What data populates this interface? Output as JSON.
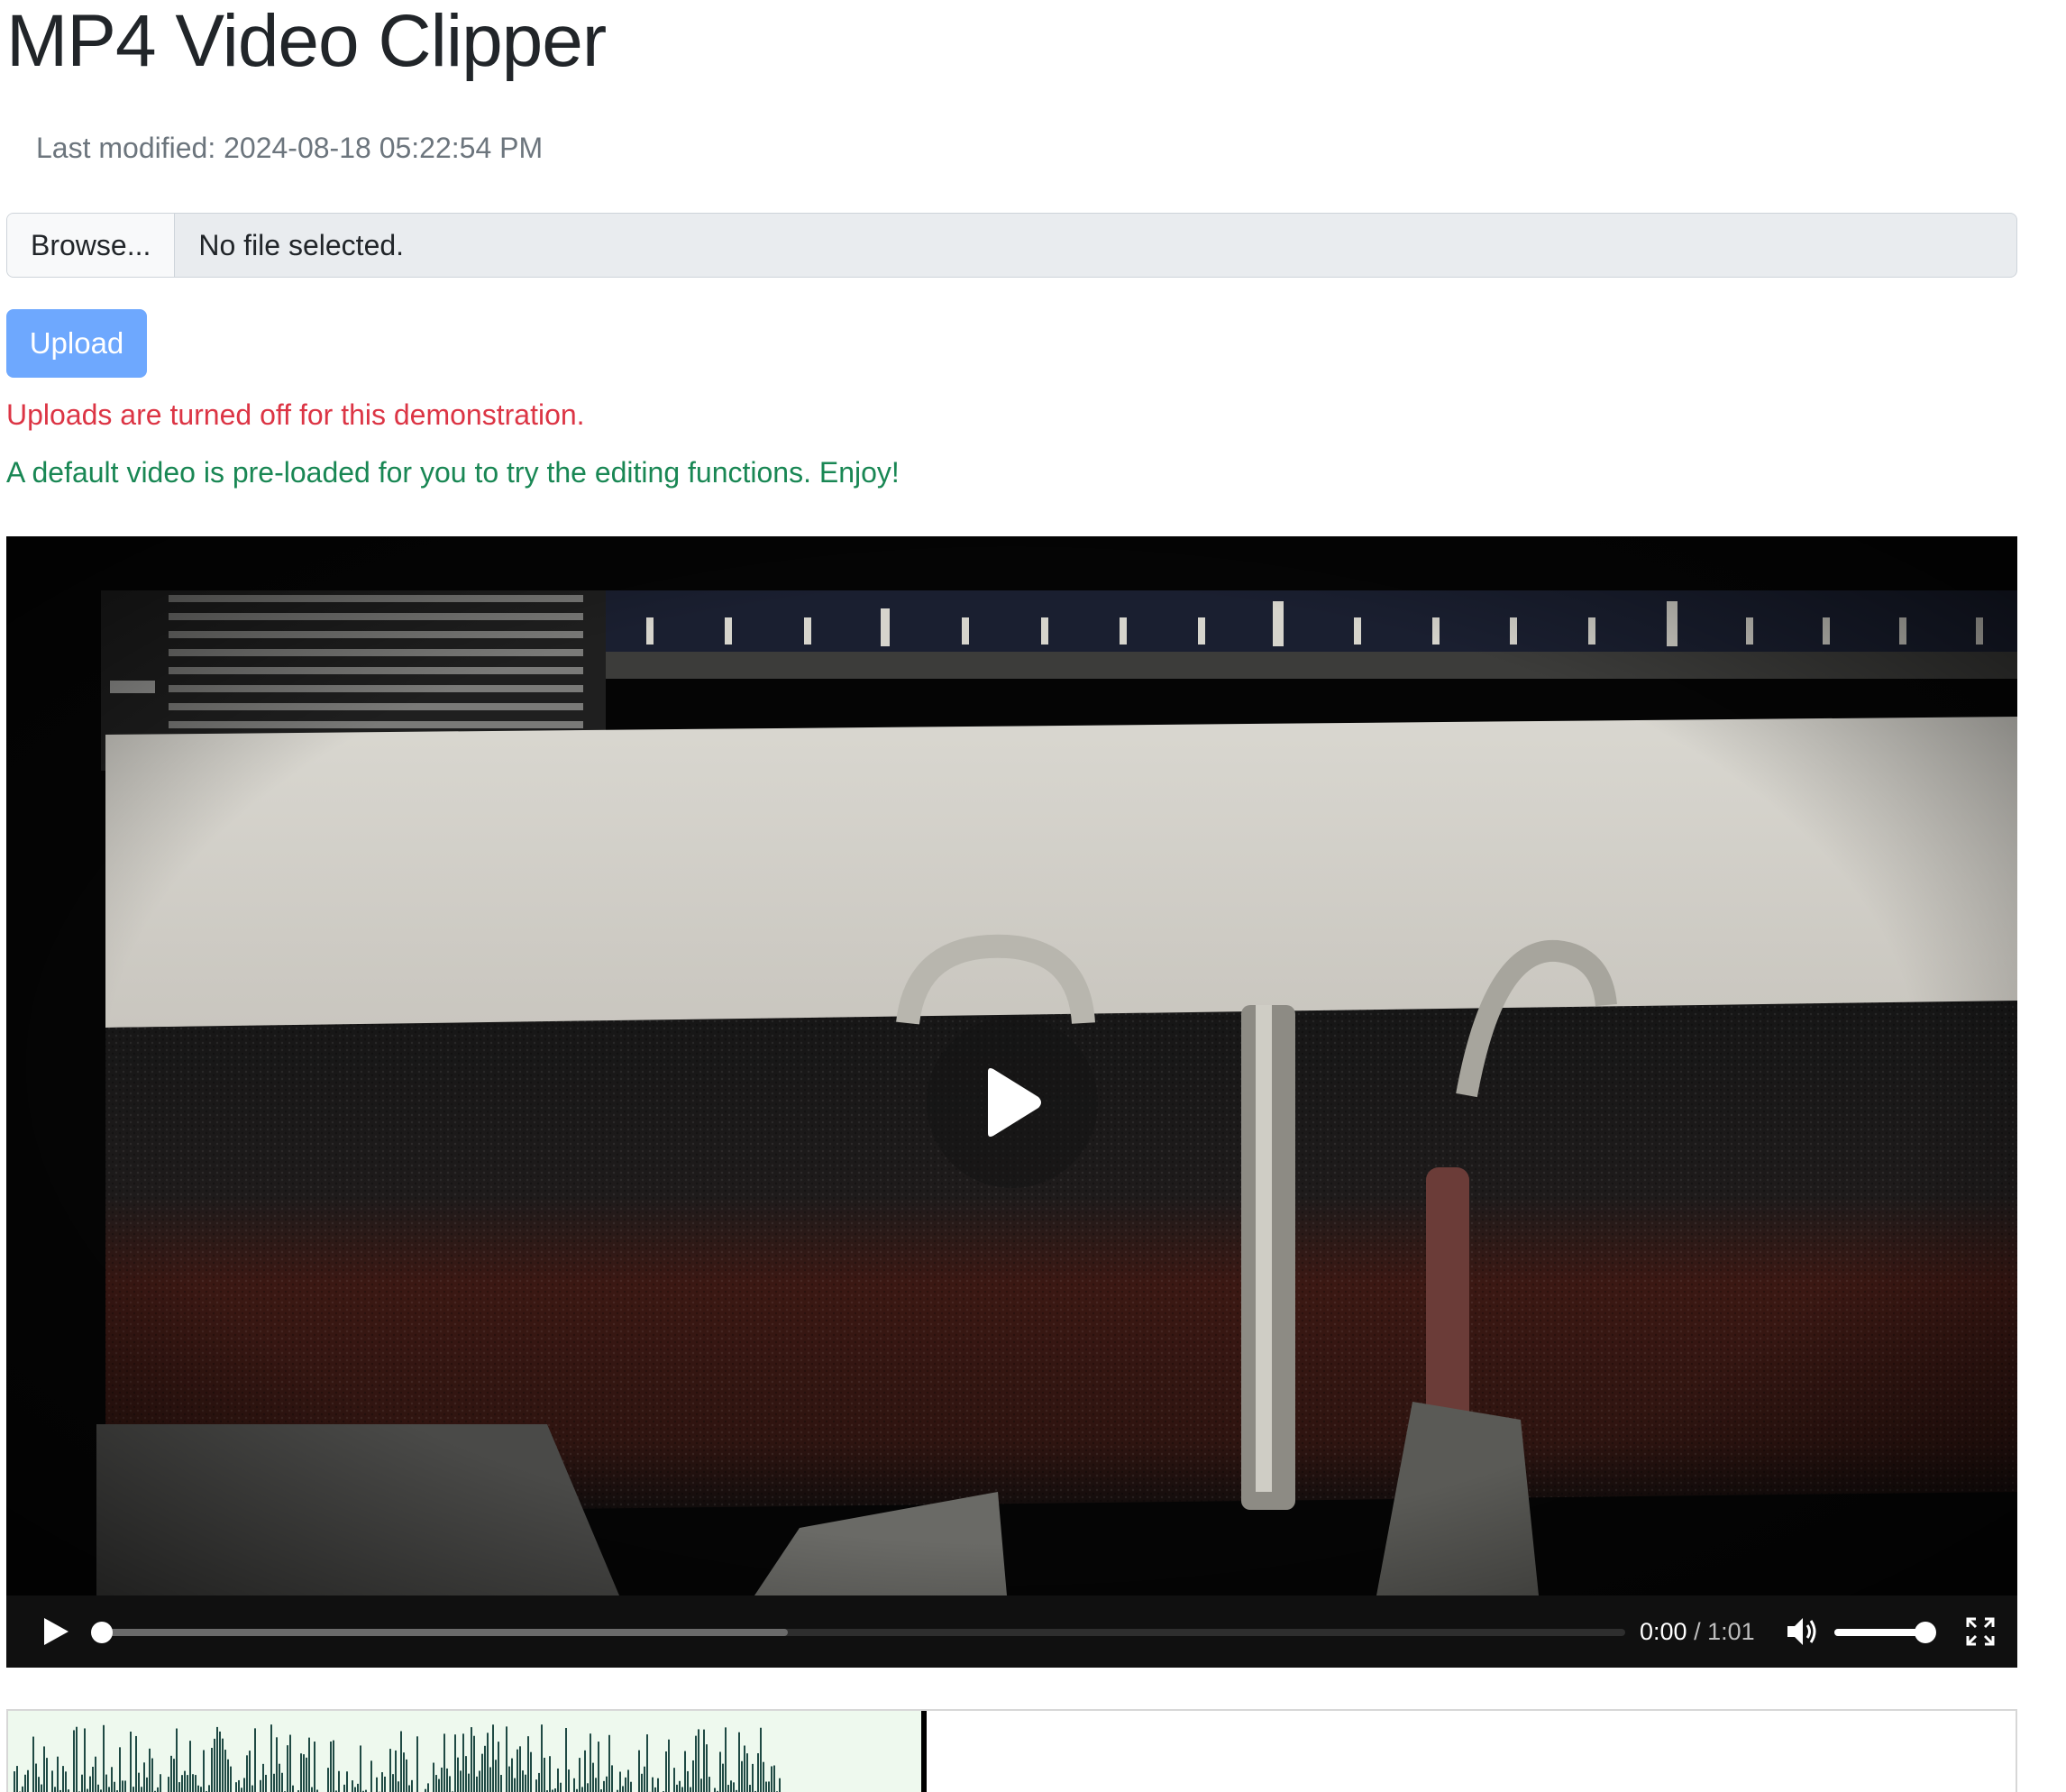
{
  "page": {
    "title": "MP4 Video Clipper",
    "last_modified": "Last modified: 2024-08-18 05:22:54 PM"
  },
  "file_input": {
    "browse_label": "Browse...",
    "file_status": "No file selected."
  },
  "upload": {
    "label": "Upload",
    "color": "#6ea8fe"
  },
  "messages": {
    "error": "Uploads are turned off for this demonstration.",
    "error_color": "#dc3545",
    "info": "A default video is pre-loaded for you to try the editing functions. Enjoy!",
    "info_color": "#198754"
  },
  "player": {
    "current_time": "0:00",
    "separator": " / ",
    "duration": "1:01",
    "progress_fraction": 0.0,
    "buffered_fraction": 0.45,
    "volume_fraction": 0.92,
    "icons": {
      "big_play": "play-icon",
      "play": "play-icon",
      "volume": "speaker-icon",
      "fullscreen": "fullscreen-icon"
    }
  },
  "waveform": {
    "region_fraction": 0.455,
    "cursor_fraction": 0.455,
    "wave_color": "#1f4a44",
    "region_color": "#eef9ee"
  }
}
